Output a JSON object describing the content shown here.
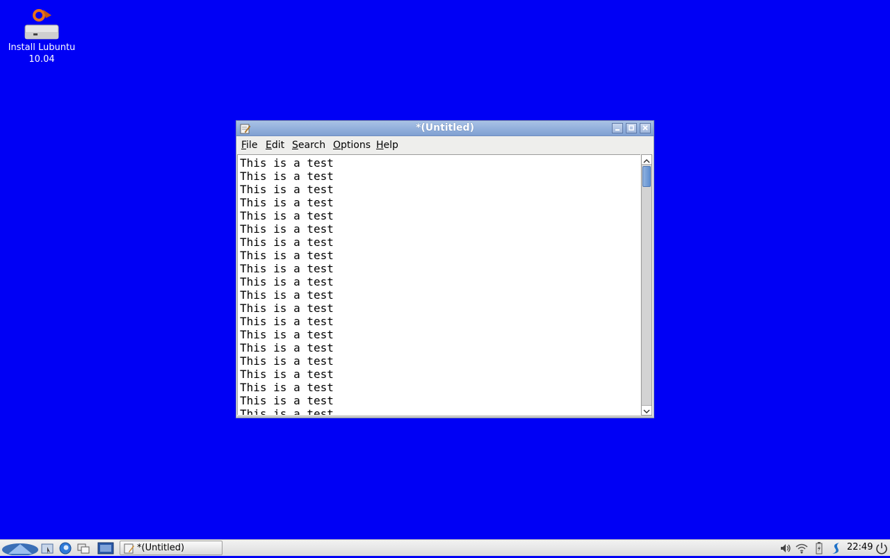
{
  "desktop": {
    "background": "#0000f5",
    "icons": [
      {
        "label": "Install Lubuntu\n10.04",
        "icon": "installer-drive-icon"
      }
    ]
  },
  "window": {
    "title": "*(Untitled)",
    "app_icon": "text-editor-icon",
    "controls": {
      "minimize": "minimize-icon",
      "maximize": "maximize-icon",
      "close": "close-icon"
    },
    "menu": [
      "File",
      "Edit",
      "Search",
      "Options",
      "Help"
    ],
    "editor_lines": [
      "This is a test",
      "This is a test",
      "This is a test",
      "This is a test",
      "This is a test",
      "This is a test",
      "This is a test",
      "This is a test",
      "This is a test",
      "This is a test",
      "This is a test",
      "This is a test",
      "This is a test",
      "This is a test",
      "This is a test",
      "This is a test",
      "This is a test",
      "This is a test",
      "This is a test",
      "This is a test"
    ]
  },
  "taskbar": {
    "launchers": [
      "start-menu-icon",
      "file-manager-icon",
      "web-browser-icon",
      "switch-desktops-icon",
      "show-desktop-icon"
    ],
    "task_title": "*(Untitled)",
    "tray": [
      "volume-icon",
      "wifi-icon",
      "battery-icon",
      "update-notifier-icon"
    ],
    "clock": "22:49",
    "power_icon": "power-icon"
  }
}
